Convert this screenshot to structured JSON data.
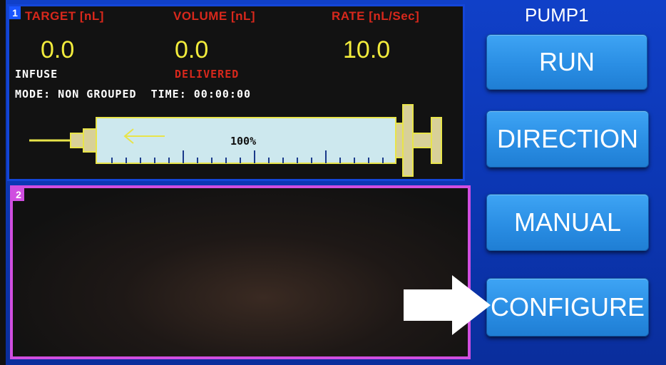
{
  "pump_title": "PUMP1",
  "panel1": {
    "number": "1",
    "headers": {
      "target": "TARGET [nL]",
      "volume": "VOLUME [nL]",
      "rate": "RATE [nL/Sec]"
    },
    "values": {
      "target": "0.0",
      "volume": "0.0",
      "rate": "10.0"
    },
    "target_sub": "INFUSE",
    "volume_sub": "DELIVERED",
    "mode_line": "MODE: NON GROUPED  TIME: 00:00:00",
    "syringe_percent": "100%"
  },
  "panel2": {
    "number": "2"
  },
  "buttons": {
    "run": "RUN",
    "direction": "DIRECTION",
    "manual": "MANUAL",
    "configure": "CONFIGURE"
  },
  "colors": {
    "header_red": "#d8281c",
    "value_yellow": "#f2ec3c",
    "button_blue": "#2a8ee4",
    "panel1_border": "#1446d8",
    "panel2_border": "#d04ee0"
  },
  "icons": {
    "pointer": "white-arrow-icon",
    "syringe": "syringe-icon",
    "direction": "left-arrow-icon"
  }
}
